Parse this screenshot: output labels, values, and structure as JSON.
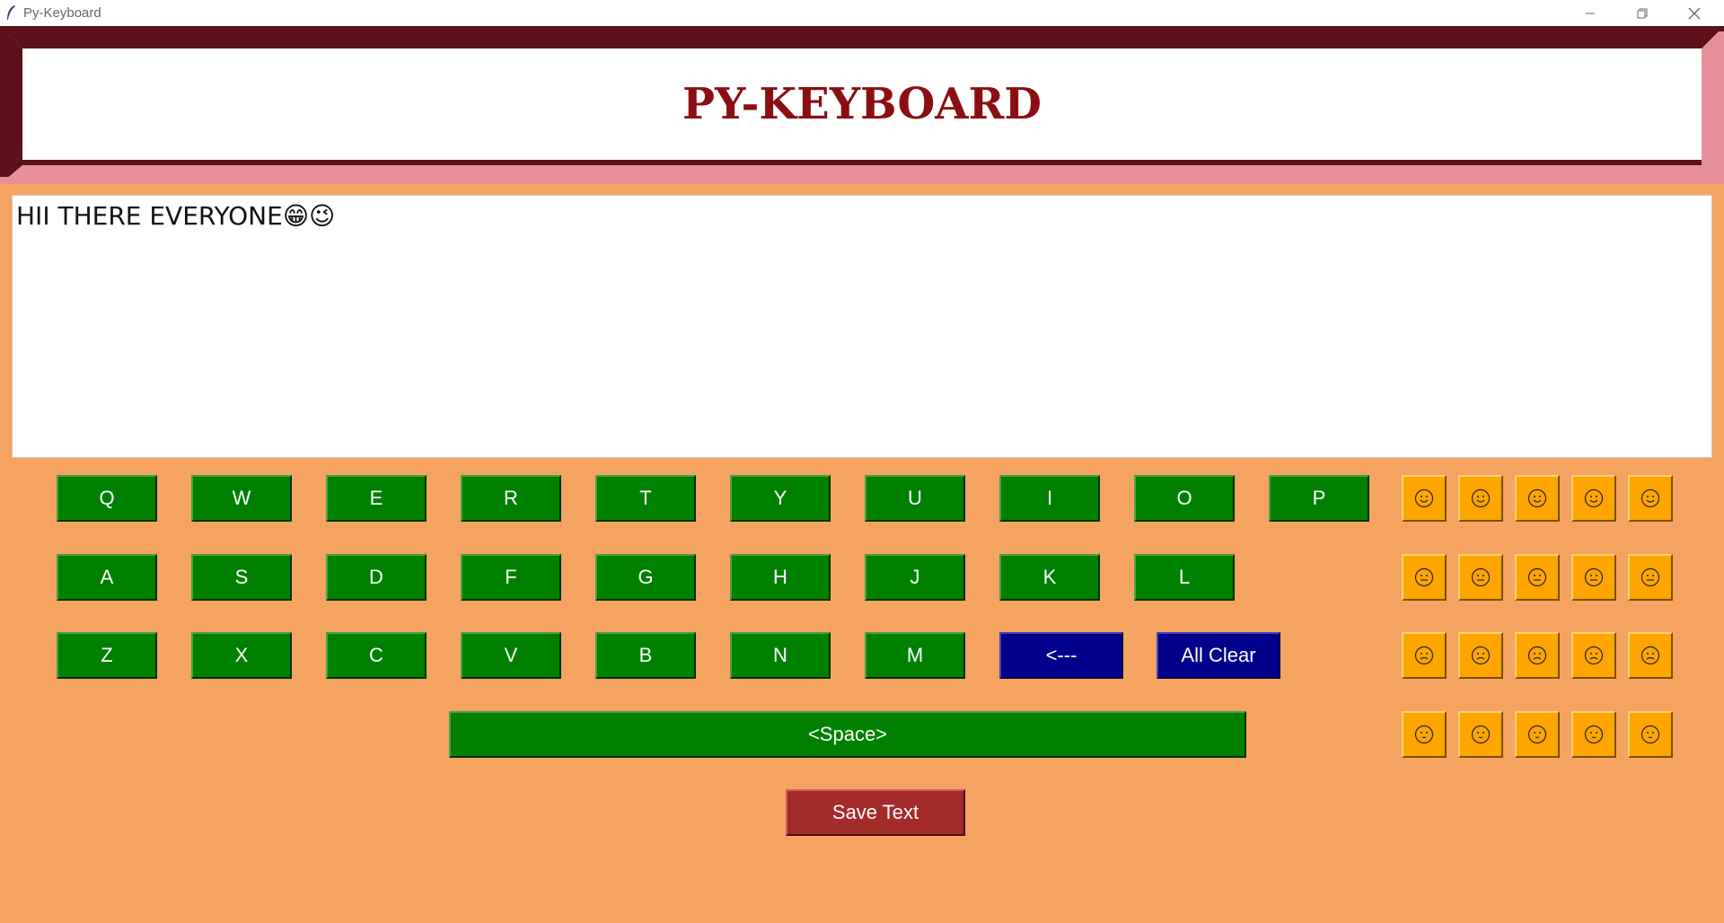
{
  "window": {
    "title": "Py-Keyboard"
  },
  "header": {
    "title": "PY-KEYBOARD"
  },
  "text_area": {
    "value": "HII THERE EVERYONE😁😉"
  },
  "keyboard": {
    "row1": [
      "Q",
      "W",
      "E",
      "R",
      "T",
      "Y",
      "U",
      "I",
      "O",
      "P"
    ],
    "row2": [
      "A",
      "S",
      "D",
      "F",
      "G",
      "H",
      "J",
      "K",
      "L"
    ],
    "row3": [
      "Z",
      "X",
      "C",
      "V",
      "B",
      "N",
      "M"
    ],
    "backspace_label": "<---",
    "all_clear_label": "All Clear",
    "space_label": "<Space>",
    "save_label": "Save Text"
  },
  "emojis": {
    "row1": [
      "😀",
      "😁",
      "😂",
      "😃",
      "😄"
    ],
    "row2": [
      "😆",
      "😆",
      "😇",
      "😈",
      "😉"
    ],
    "row3": [
      "😐",
      "😑",
      "😒",
      "😓",
      "😌"
    ],
    "row4": [
      "😕",
      "😖",
      "😗",
      "😘",
      "😙"
    ]
  },
  "colors": {
    "background": "#f4a460",
    "key_green": "#008000",
    "key_blue": "#00008b",
    "save_red": "#a52a2a",
    "emoji_orange": "#ffa500",
    "title_red": "#8b0f12",
    "frame_dark": "#5c1218",
    "frame_pink": "#e8909a"
  }
}
